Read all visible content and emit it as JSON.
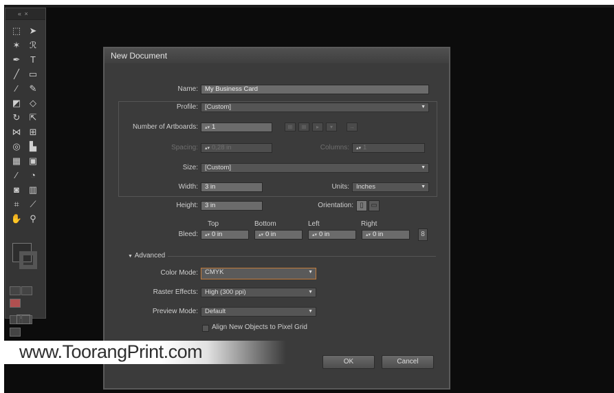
{
  "dialog": {
    "title": "New Document",
    "name_label": "Name:",
    "name_value": "My Business Card",
    "profile_label": "Profile:",
    "profile_value": "[Custom]",
    "artboards_label": "Number of Artboards:",
    "artboards_value": "1",
    "spacing_label": "Spacing:",
    "spacing_value": "0,28 in",
    "columns_label": "Columns:",
    "columns_value": "1",
    "size_label": "Size:",
    "size_value": "[Custom]",
    "width_label": "Width:",
    "width_value": "3 in",
    "units_label": "Units:",
    "units_value": "Inches",
    "height_label": "Height:",
    "height_value": "3 in",
    "orientation_label": "Orientation:",
    "bleed_label": "Bleed:",
    "bleed_top_label": "Top",
    "bleed_bottom_label": "Bottom",
    "bleed_left_label": "Left",
    "bleed_right_label": "Right",
    "bleed_top": "0 in",
    "bleed_bottom": "0 in",
    "bleed_left": "0 in",
    "bleed_right": "0 in",
    "advanced_label": "Advanced",
    "color_mode_label": "Color Mode:",
    "color_mode_value": "CMYK",
    "raster_label": "Raster Effects:",
    "raster_value": "High (300 ppi)",
    "preview_label": "Preview Mode:",
    "preview_value": "Default",
    "align_label": "Align New Objects to Pixel Grid",
    "ok_label": "OK",
    "cancel_label": "Cancel"
  },
  "watermark": "www.ToorangPrint.com",
  "colors": {
    "background": "#0c0c0c",
    "panel": "#353535",
    "dialog": "#3b3b3b",
    "focus": "#c27b3a"
  }
}
